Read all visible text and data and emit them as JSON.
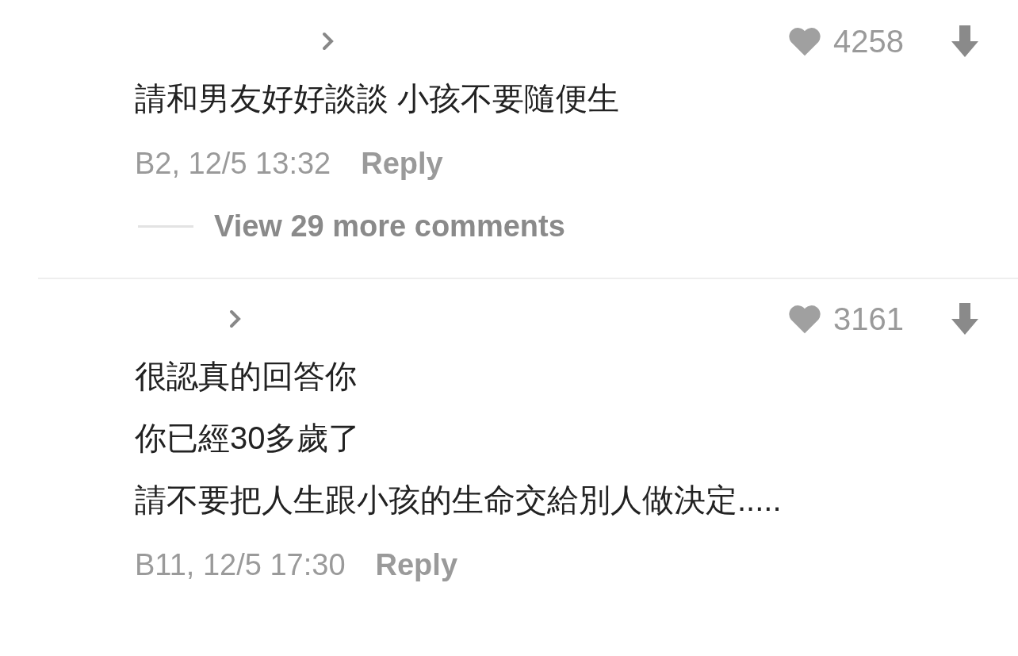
{
  "comments": [
    {
      "likes": "4258",
      "lines": [
        "請和男友好好談談 小孩不要隨便生"
      ],
      "meta": "B2, 12/5 13:32",
      "reply": "Reply",
      "more": "View 29 more comments"
    },
    {
      "likes": "3161",
      "lines": [
        "很認真的回答你",
        "你已經30多歲了",
        "請不要把人生跟小孩的生命交給別人做決定....."
      ],
      "meta": "B11, 12/5 17:30",
      "reply": "Reply"
    }
  ]
}
